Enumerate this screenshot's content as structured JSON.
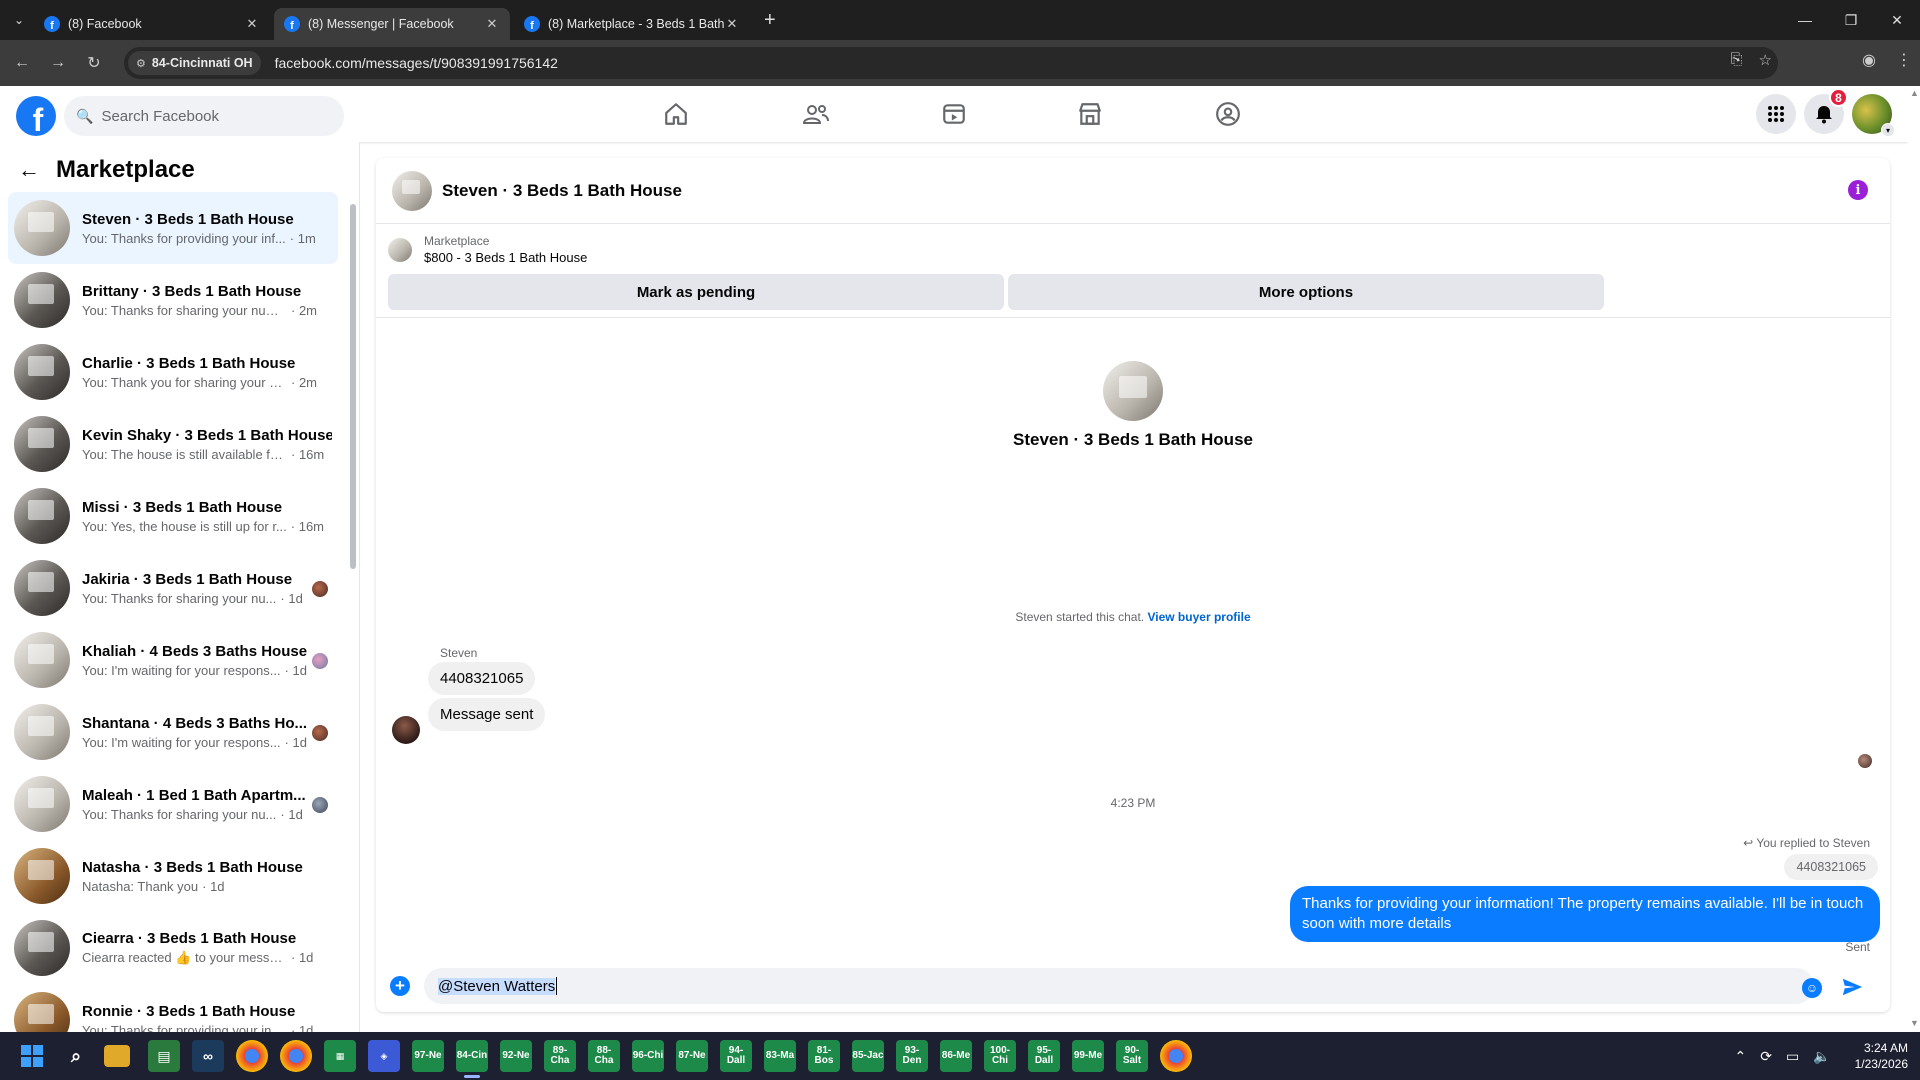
{
  "browser": {
    "tabs": [
      {
        "title": "(8) Facebook",
        "active": false
      },
      {
        "title": "(8) Messenger | Facebook",
        "active": true
      },
      {
        "title": "(8) Marketplace - 3 Beds 1 Bath",
        "active": false
      }
    ],
    "site_chip": "84-Cincinnati OH",
    "url": "facebook.com/messages/t/908391991756142"
  },
  "fb": {
    "logo": "f",
    "search_placeholder": "Search Facebook",
    "notification_count": "8",
    "nav_icons": [
      "home-icon",
      "friends-icon",
      "video-icon",
      "marketplace-icon",
      "groups-icon"
    ]
  },
  "sidebar": {
    "title": "Marketplace",
    "conversations": [
      {
        "name": "Steven · 3 Beds 1 Bath House",
        "snippet": "You: Thanks for providing your inf...",
        "time": "1m",
        "active": true,
        "seen": ""
      },
      {
        "name": "Brittany · 3 Beds 1 Bath House",
        "snippet": "You: Thanks for sharing your numb...",
        "time": "2m",
        "active": false,
        "seen": ""
      },
      {
        "name": "Charlie · 3 Beds 1 Bath House",
        "snippet": "You: Thank you for sharing your co...",
        "time": "2m",
        "active": false,
        "seen": ""
      },
      {
        "name": "Kevin Shaky · 3 Beds 1 Bath House",
        "snippet": "You: The house is still available fo...",
        "time": "16m",
        "active": false,
        "seen": ""
      },
      {
        "name": "Missi · 3 Beds 1 Bath House",
        "snippet": "You: Yes, the house is still up for r...",
        "time": "16m",
        "active": false,
        "seen": ""
      },
      {
        "name": "Jakiria · 3 Beds 1 Bath House",
        "snippet": "You: Thanks for sharing your nu...",
        "time": "1d",
        "active": false,
        "seen": "brown"
      },
      {
        "name": "Khaliah · 4 Beds 3 Baths House",
        "snippet": "You: I'm waiting for your respons...",
        "time": "1d",
        "active": false,
        "seen": "alt"
      },
      {
        "name": "Shantana · 4 Beds 3 Baths Ho...",
        "snippet": "You: I'm waiting for your respons...",
        "time": "1d",
        "active": false,
        "seen": "brown"
      },
      {
        "name": "Maleah · 1 Bed 1 Bath Apartm...",
        "snippet": "You: Thanks for sharing your nu...",
        "time": "1d",
        "active": false,
        "seen": "grey"
      },
      {
        "name": "Natasha · 3 Beds 1 Bath House",
        "snippet": "Natasha: Thank you",
        "time": "1d",
        "active": false,
        "seen": ""
      },
      {
        "name": "Ciearra · 3 Beds 1 Bath House",
        "snippet": "Ciearra reacted 👍 to your message",
        "time": "1d",
        "active": false,
        "seen": ""
      },
      {
        "name": "Ronnie · 3 Beds 1 Bath House",
        "snippet": "You: Thanks for providing your info...",
        "time": "1d",
        "active": false,
        "seen": ""
      }
    ]
  },
  "chat": {
    "header_name": "Steven · 3 Beds 1 Bath House",
    "listing_label": "Marketplace",
    "listing_price": "$800 - 3 Beds 1 Bath House",
    "mark_pending_label": "Mark as pending",
    "more_options_label": "More options",
    "intro_name": "Steven · 3 Beds 1 Bath House",
    "started_text": "Steven started this chat.",
    "view_profile_link": "View buyer profile",
    "sender_name": "Steven",
    "incoming_messages": [
      "4408321065",
      "Message sent"
    ],
    "timestamp": "4:23 PM",
    "replied_text": "You replied to Steven",
    "quoted_text": "4408321065",
    "outgoing_message": "Thanks for providing your information! The property remains available. I'll be in touch soon with more details",
    "sent_status": "Sent",
    "composer_value": "@Steven Watters"
  },
  "taskbar": {
    "apps": [
      "97-Ne",
      "84-Cin",
      "92-Ne",
      "89-Cha",
      "88-Cha",
      "96-Chi",
      "87-Ne",
      "94-Dall",
      "83-Ma",
      "81-Bos",
      "85-Jac",
      "93-Den",
      "86-Me",
      "100-Chi",
      "95-Dall",
      "99-Me",
      "90-Salt"
    ],
    "time": "3:24 AM",
    "date": "1/23/2026"
  }
}
